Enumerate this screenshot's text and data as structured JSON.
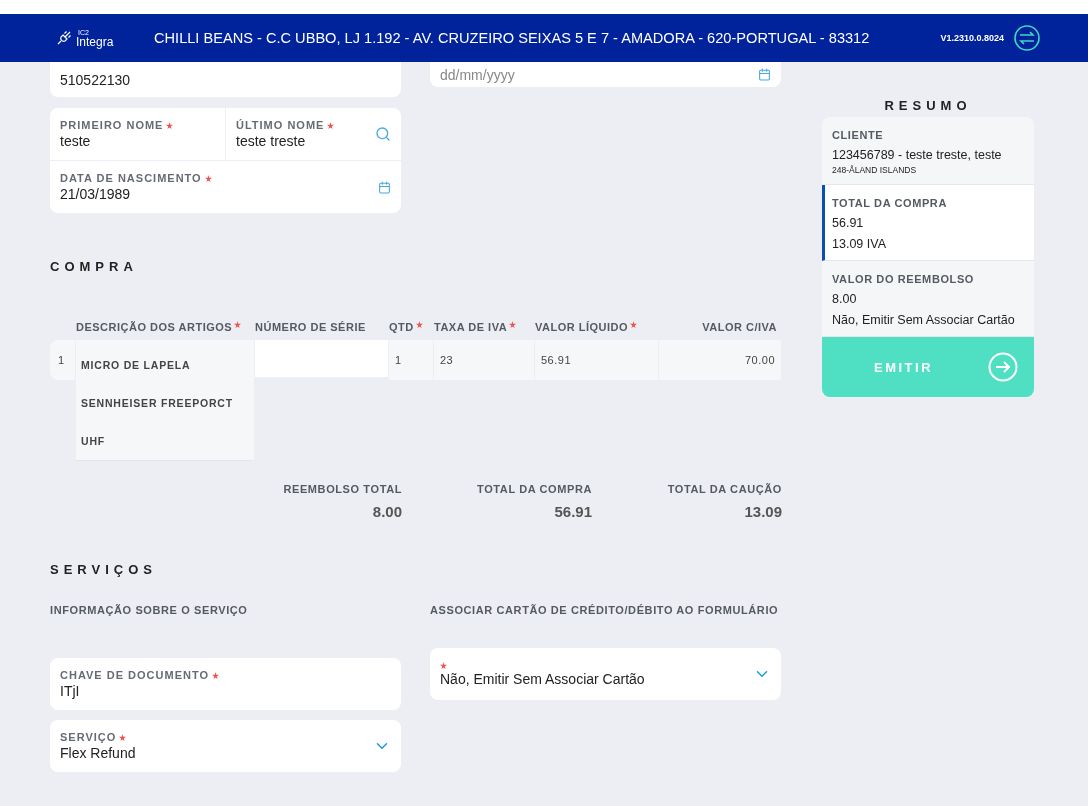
{
  "header": {
    "logo_superscript": "IC2",
    "logo_name": "Integra",
    "store": "CHILLI BEANS - C.C UBBO, LJ 1.192 - AV. CRUZEIRO SEIXAS 5 E 7 - AMADORA - 620-PORTUGAL - 83312",
    "version": "V1.2310.0.8024"
  },
  "top_fields": [
    {
      "kind": "input",
      "value": "510522130"
    },
    {
      "kind": "date",
      "placeholder": "dd/mm/yyyy"
    }
  ],
  "name_fields": [
    {
      "label": "PRIMEIRO NOME",
      "required": true,
      "value": "teste"
    },
    {
      "label": "ÚLTIMO NOME",
      "required": true,
      "value": "teste treste"
    }
  ],
  "birth_field": {
    "label": "DATA DE NASCIMENTO",
    "required": true,
    "value": "21/03/1989"
  },
  "compra": {
    "title": "COMPRA",
    "columns": [
      {
        "label": "DESCRIÇÃO DOS ARTIGOS",
        "required": true
      },
      {
        "label": "NÚMERO DE SÉRIE",
        "required": false
      },
      {
        "label": "QTD",
        "required": true
      },
      {
        "label": "TAXA DE IVA",
        "required": true
      },
      {
        "label": "VALOR LÍQUIDO",
        "required": true
      },
      {
        "label": "VALOR C/IVA",
        "required": false
      }
    ],
    "rows": [
      {
        "index": "1",
        "description": [
          "MICRO DE LAPELA",
          "SENNHEISER FREEPORCT",
          "UHF"
        ],
        "serial": "",
        "qty": "1",
        "tax": "23",
        "net": "56.91",
        "gross": "70.00"
      }
    ],
    "totals": [
      {
        "label": "REEMBOLSO TOTAL",
        "value": "8.00"
      },
      {
        "label": "TOTAL DA COMPRA",
        "value": "56.91"
      },
      {
        "label": "TOTAL DA CAUÇÃO",
        "value": "13.09"
      }
    ]
  },
  "servicos": {
    "title": "SERVIÇOS",
    "left_heading": "INFORMAÇÃO SOBRE O SERVIÇO",
    "right_heading": "ASSOCIAR CARTÃO DE CRÉDITO/DÉBITO AO FORMULÁRIO",
    "left_fields": [
      {
        "kind": "input",
        "label": "CHAVE DE DOCUMENTO",
        "required": true,
        "value": "ITjI"
      },
      {
        "kind": "select",
        "label": "SERVIÇO",
        "required": true,
        "value": "Flex Refund"
      }
    ],
    "right_fields": [
      {
        "kind": "select",
        "required": true,
        "value": "Não, Emitir Sem Associar Cartão"
      }
    ]
  },
  "resumo": {
    "title": "RESUMO",
    "sections": [
      {
        "label": "CLIENTE",
        "lines": [
          "123456789  -  teste treste, teste"
        ],
        "small": "248-ÅLAND ISLANDS",
        "selected": false
      },
      {
        "label": "TOTAL DA COMPRA",
        "lines": [
          "56.91",
          "13.09 IVA"
        ],
        "selected": true
      },
      {
        "label": "VALOR DO REEMBOLSO",
        "lines": [
          "8.00",
          "Não, Emitir Sem Associar Cartão"
        ],
        "selected": false
      }
    ],
    "button": "EMITIR"
  }
}
